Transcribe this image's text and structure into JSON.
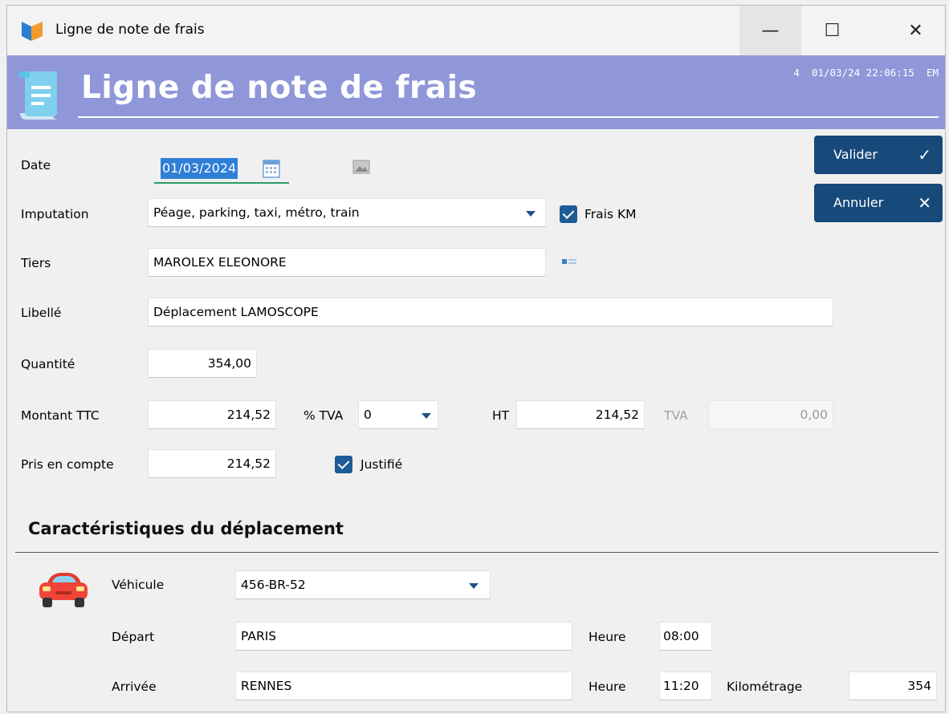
{
  "window": {
    "title": "Ligne de note de frais",
    "minimize": "—",
    "maximize": "☐",
    "close": "✕"
  },
  "banner": {
    "title": "Ligne de note de frais",
    "meta": "4  01/03/24 22:06:15  EM"
  },
  "form": {
    "date_label": "Date",
    "date_value": "01/03/2024",
    "imputation_label": "Imputation",
    "imputation_value": "Péage, parking, taxi, métro, train",
    "frais_km_label": "Frais KM",
    "frais_km_checked": true,
    "tiers_label": "Tiers",
    "tiers_value": "MAROLEX ELEONORE",
    "libelle_label": "Libellé",
    "libelle_value": "Déplacement LAMOSCOPE",
    "quantite_label": "Quantité",
    "quantite_value": "354,00",
    "montant_ttc_label": "Montant TTC",
    "montant_ttc_value": "214,52",
    "tva_pct_label": "% TVA",
    "tva_pct_value": "0",
    "ht_label": "HT",
    "ht_value": "214,52",
    "tva_label": "TVA",
    "tva_value": "0,00",
    "pris_label": "Pris en compte",
    "pris_value": "214,52",
    "justifie_label": "Justifié",
    "justifie_checked": true
  },
  "buttons": {
    "valider": "Valider",
    "valider_icon": "✓",
    "annuler": "Annuler",
    "annuler_icon": "✕"
  },
  "trip": {
    "section_title": "Caractéristiques du déplacement",
    "vehicule_label": "Véhicule",
    "vehicule_value": "456-BR-52",
    "depart_label": "Départ",
    "depart_value": "PARIS",
    "heure_label": "Heure",
    "depart_heure": "08:00",
    "arrivee_label": "Arrivée",
    "arrivee_value": "RENNES",
    "arrivee_heure": "11:20",
    "kilometrage_label": "Kilométrage",
    "kilometrage_value": "354"
  },
  "colors": {
    "banner": "#8f97d9",
    "button": "#17497a",
    "checkbox": "#1d5c96",
    "accent_caret": "#1e4f8a"
  }
}
